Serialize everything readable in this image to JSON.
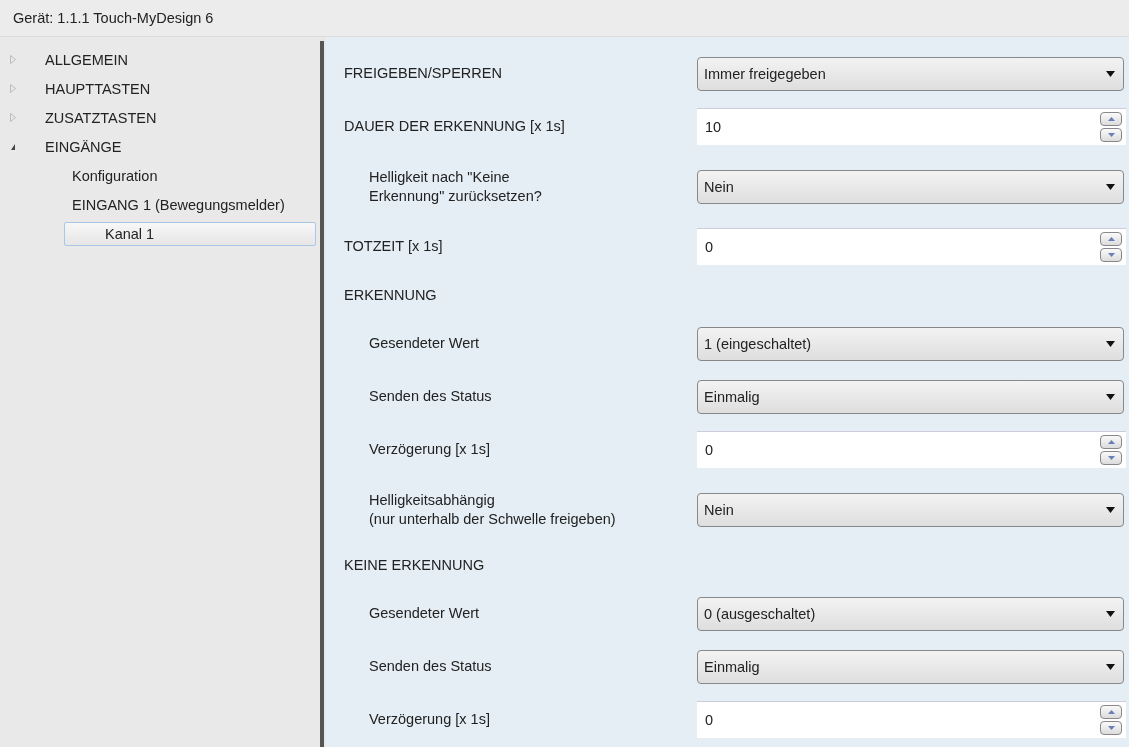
{
  "window": {
    "title": "Gerät: 1.1.1  Touch-MyDesign 6"
  },
  "tree": [
    {
      "label": "ALLGEMEIN",
      "expanded": false,
      "selected": false
    },
    {
      "label": "HAUPTTASTEN",
      "expanded": false,
      "selected": false
    },
    {
      "label": "ZUSATZTASTEN",
      "expanded": false,
      "selected": false
    },
    {
      "label": "EINGÄNGE",
      "expanded": true,
      "selected": false,
      "children": [
        {
          "label": "Konfiguration",
          "selected": false
        },
        {
          "label": "EINGANG 1 (Bewegungsmelder)",
          "selected": false,
          "children": [
            {
              "label": "Kanal 1",
              "selected": true
            }
          ]
        }
      ]
    }
  ],
  "parameters": [
    {
      "kind": "dropdown",
      "label": "FREIGEBEN/SPERREN",
      "value": "Immer freigegeben"
    },
    {
      "kind": "spin",
      "label": "DAUER DER ERKENNUNG [x 1s]",
      "value": "10",
      "children": [
        {
          "kind": "dropdown",
          "label": "Helligkeit nach \"Keine\nErkennung\" zurücksetzen?",
          "value": "Nein"
        }
      ]
    },
    {
      "kind": "spin",
      "label": "TOTZEIT [x 1s]",
      "value": "0"
    },
    {
      "kind": "section",
      "label": "ERKENNUNG",
      "children": [
        {
          "kind": "dropdown",
          "label": "Gesendeter Wert",
          "value": "1 (eingeschaltet)"
        },
        {
          "kind": "dropdown",
          "label": "Senden des Status",
          "value": "Einmalig"
        },
        {
          "kind": "spin",
          "label": "Verzögerung [x 1s]",
          "value": "0"
        },
        {
          "kind": "dropdown",
          "label": "Helligkeitsabhängig\n(nur unterhalb der Schwelle freigeben)",
          "value": "Nein"
        }
      ]
    },
    {
      "kind": "section",
      "label": "KEINE ERKENNUNG",
      "children": [
        {
          "kind": "dropdown",
          "label": "Gesendeter Wert",
          "value": "0 (ausgeschaltet)"
        },
        {
          "kind": "dropdown",
          "label": "Senden des Status",
          "value": "Einmalig"
        },
        {
          "kind": "spin",
          "label": "Verzögerung [x 1s]",
          "value": "0"
        }
      ]
    }
  ]
}
